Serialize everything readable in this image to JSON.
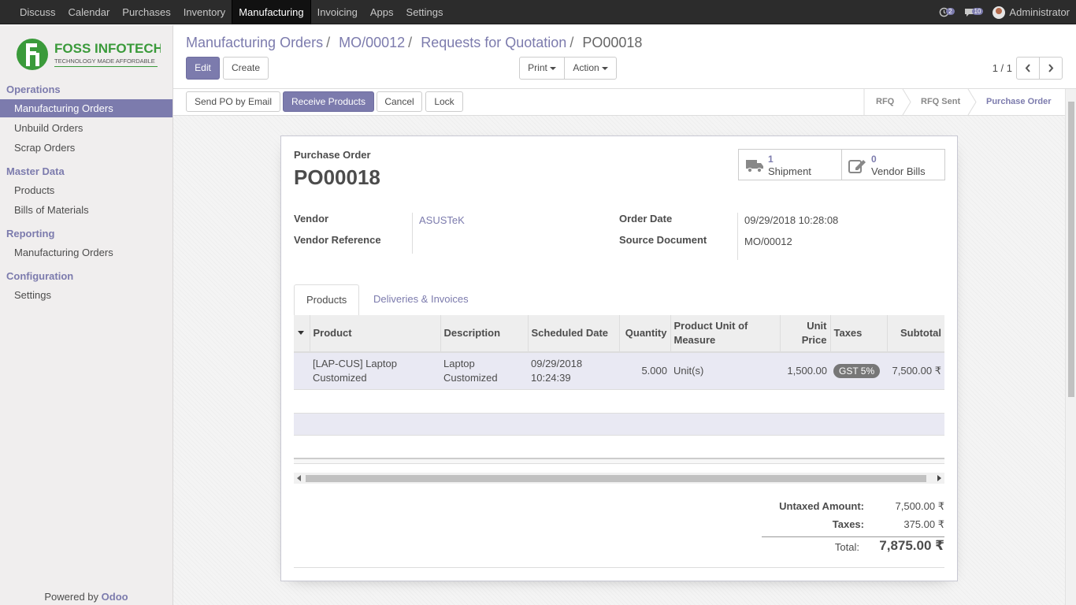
{
  "topbar": {
    "menu": [
      "Discuss",
      "Calendar",
      "Purchases",
      "Inventory",
      "Manufacturing",
      "Invoicing",
      "Apps",
      "Settings"
    ],
    "active": "Manufacturing",
    "activity_count": "2",
    "message_count": "10",
    "user": "Administrator"
  },
  "sidebar": {
    "logo": {
      "name": "FOSS INFOTECH",
      "tagline": "TECHNOLOGY MADE AFFORDABLE"
    },
    "sections": {
      "operations": "Operations",
      "master_data": "Master Data",
      "reporting": "Reporting",
      "configuration": "Configuration"
    },
    "items": {
      "manufacturing_orders": "Manufacturing Orders",
      "unbuild_orders": "Unbuild Orders",
      "scrap_orders": "Scrap Orders",
      "products": "Products",
      "bills_of_materials": "Bills of Materials",
      "reporting_mo": "Manufacturing Orders",
      "settings": "Settings"
    },
    "powered_prefix": "Powered by",
    "powered_brand": "Odoo"
  },
  "breadcrumb": {
    "items": [
      "Manufacturing Orders",
      "MO/00012",
      "Requests for Quotation"
    ],
    "current": "PO00018"
  },
  "controls": {
    "edit": "Edit",
    "create": "Create",
    "print": "Print",
    "action": "Action",
    "pager": "1 / 1"
  },
  "statusbar": {
    "buttons": {
      "send_po": "Send PO by Email",
      "receive": "Receive Products",
      "cancel": "Cancel",
      "lock": "Lock"
    },
    "stages": [
      "RFQ",
      "RFQ Sent",
      "Purchase Order"
    ],
    "current_stage": "Purchase Order"
  },
  "form": {
    "doc_type": "Purchase Order",
    "name": "PO00018",
    "smart_buttons": {
      "shipment": {
        "count": "1",
        "label": "Shipment"
      },
      "bills": {
        "count": "0",
        "label": "Vendor Bills"
      }
    },
    "fields": {
      "vendor_label": "Vendor",
      "vendor": "ASUSTeK",
      "vendor_ref_label": "Vendor Reference",
      "vendor_ref": "",
      "order_date_label": "Order Date",
      "order_date": "09/29/2018 10:28:08",
      "source_doc_label": "Source Document",
      "source_doc": "MO/00012"
    },
    "tabs": [
      "Products",
      "Deliveries & Invoices"
    ],
    "table": {
      "headers": {
        "product": "Product",
        "description": "Description",
        "scheduled": "Scheduled Date",
        "quantity": "Quantity",
        "uom": "Product Unit of Measure",
        "unit_price": "Unit Price",
        "taxes": "Taxes",
        "subtotal": "Subtotal"
      },
      "rows": [
        {
          "product": "[LAP-CUS] Laptop Customized",
          "description": "Laptop Customized",
          "scheduled": "09/29/2018 10:24:39",
          "quantity": "5.000",
          "uom": "Unit(s)",
          "unit_price": "1,500.00",
          "tax": "GST 5%",
          "subtotal": "7,500.00 ₹"
        }
      ]
    },
    "totals": {
      "untaxed_label": "Untaxed Amount:",
      "untaxed": "7,500.00 ₹",
      "taxes_label": "Taxes:",
      "taxes": "375.00 ₹",
      "total_label": "Total:",
      "total": "7,875.00 ₹"
    }
  }
}
